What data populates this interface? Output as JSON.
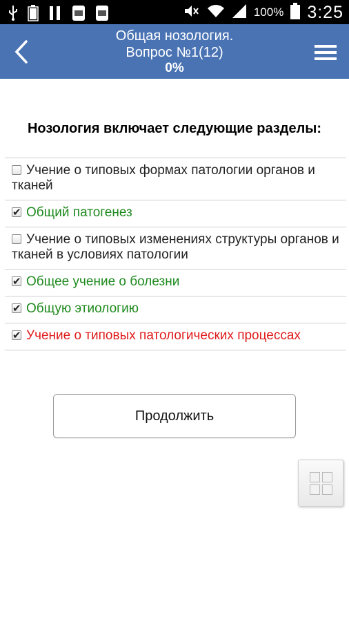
{
  "status_bar": {
    "battery_percent": "100%",
    "time": "3:25",
    "left_icons": [
      "usb-icon",
      "battery-100-icon",
      "pause-icon",
      "galaxy-icon",
      "galaxy-icon-2"
    ],
    "right_icons": [
      "mute-icon",
      "wifi-icon",
      "signal-icon",
      "battery-icon"
    ]
  },
  "header": {
    "title_line1": "Общая нозология.",
    "title_line2": "Вопрос №1(12)",
    "progress": "0%",
    "back_icon": "chevron-left-icon",
    "menu_icon": "hamburger-menu-icon",
    "color": "#4a73b4"
  },
  "question": {
    "text": "Нозология включает следующие разделы:"
  },
  "options": [
    {
      "label": "Учение о типовых формах патологии органов и тканей",
      "checked": false,
      "state": "neutral"
    },
    {
      "label": "Общий патогенез",
      "checked": true,
      "state": "correct"
    },
    {
      "label": "Учение о типовых изменениях структуры органов и тканей в условиях патологии",
      "checked": false,
      "state": "neutral"
    },
    {
      "label": "Общее учение о болезни",
      "checked": true,
      "state": "correct"
    },
    {
      "label": "Общую этиологию",
      "checked": true,
      "state": "correct"
    },
    {
      "label": "Учение о типовых патологических процессах",
      "checked": true,
      "state": "wrong"
    }
  ],
  "colors": {
    "correct": "#1e8a1e",
    "wrong": "#e01b1b",
    "neutral": "#222222"
  },
  "continue_button": {
    "label": "Продолжить"
  },
  "grid_button": {
    "icon": "grid-icon"
  }
}
